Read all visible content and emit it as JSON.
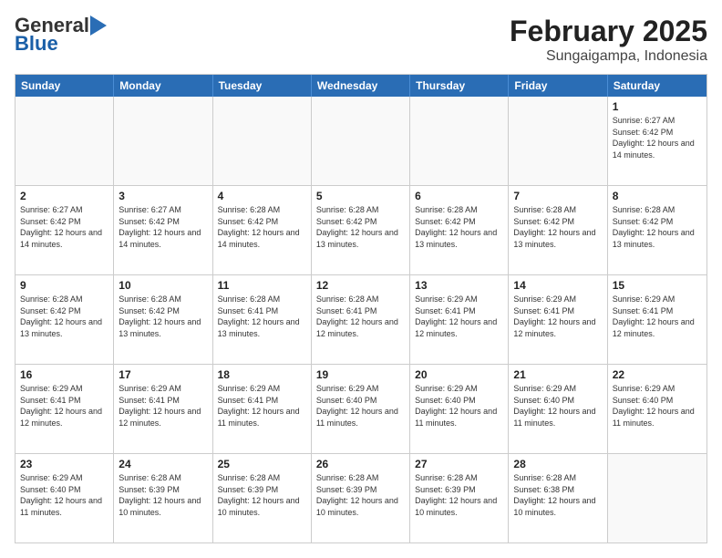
{
  "header": {
    "logo_general": "General",
    "logo_blue": "Blue",
    "main_title": "February 2025",
    "subtitle": "Sungaigampa, Indonesia"
  },
  "days_of_week": [
    "Sunday",
    "Monday",
    "Tuesday",
    "Wednesday",
    "Thursday",
    "Friday",
    "Saturday"
  ],
  "weeks": [
    [
      {
        "day": "",
        "text": "",
        "empty": true
      },
      {
        "day": "",
        "text": "",
        "empty": true
      },
      {
        "day": "",
        "text": "",
        "empty": true
      },
      {
        "day": "",
        "text": "",
        "empty": true
      },
      {
        "day": "",
        "text": "",
        "empty": true
      },
      {
        "day": "",
        "text": "",
        "empty": true
      },
      {
        "day": "1",
        "text": "Sunrise: 6:27 AM\nSunset: 6:42 PM\nDaylight: 12 hours and 14 minutes.",
        "empty": false
      }
    ],
    [
      {
        "day": "2",
        "text": "Sunrise: 6:27 AM\nSunset: 6:42 PM\nDaylight: 12 hours and 14 minutes.",
        "empty": false
      },
      {
        "day": "3",
        "text": "Sunrise: 6:27 AM\nSunset: 6:42 PM\nDaylight: 12 hours and 14 minutes.",
        "empty": false
      },
      {
        "day": "4",
        "text": "Sunrise: 6:28 AM\nSunset: 6:42 PM\nDaylight: 12 hours and 14 minutes.",
        "empty": false
      },
      {
        "day": "5",
        "text": "Sunrise: 6:28 AM\nSunset: 6:42 PM\nDaylight: 12 hours and 13 minutes.",
        "empty": false
      },
      {
        "day": "6",
        "text": "Sunrise: 6:28 AM\nSunset: 6:42 PM\nDaylight: 12 hours and 13 minutes.",
        "empty": false
      },
      {
        "day": "7",
        "text": "Sunrise: 6:28 AM\nSunset: 6:42 PM\nDaylight: 12 hours and 13 minutes.",
        "empty": false
      },
      {
        "day": "8",
        "text": "Sunrise: 6:28 AM\nSunset: 6:42 PM\nDaylight: 12 hours and 13 minutes.",
        "empty": false
      }
    ],
    [
      {
        "day": "9",
        "text": "Sunrise: 6:28 AM\nSunset: 6:42 PM\nDaylight: 12 hours and 13 minutes.",
        "empty": false
      },
      {
        "day": "10",
        "text": "Sunrise: 6:28 AM\nSunset: 6:42 PM\nDaylight: 12 hours and 13 minutes.",
        "empty": false
      },
      {
        "day": "11",
        "text": "Sunrise: 6:28 AM\nSunset: 6:41 PM\nDaylight: 12 hours and 13 minutes.",
        "empty": false
      },
      {
        "day": "12",
        "text": "Sunrise: 6:28 AM\nSunset: 6:41 PM\nDaylight: 12 hours and 12 minutes.",
        "empty": false
      },
      {
        "day": "13",
        "text": "Sunrise: 6:29 AM\nSunset: 6:41 PM\nDaylight: 12 hours and 12 minutes.",
        "empty": false
      },
      {
        "day": "14",
        "text": "Sunrise: 6:29 AM\nSunset: 6:41 PM\nDaylight: 12 hours and 12 minutes.",
        "empty": false
      },
      {
        "day": "15",
        "text": "Sunrise: 6:29 AM\nSunset: 6:41 PM\nDaylight: 12 hours and 12 minutes.",
        "empty": false
      }
    ],
    [
      {
        "day": "16",
        "text": "Sunrise: 6:29 AM\nSunset: 6:41 PM\nDaylight: 12 hours and 12 minutes.",
        "empty": false
      },
      {
        "day": "17",
        "text": "Sunrise: 6:29 AM\nSunset: 6:41 PM\nDaylight: 12 hours and 12 minutes.",
        "empty": false
      },
      {
        "day": "18",
        "text": "Sunrise: 6:29 AM\nSunset: 6:41 PM\nDaylight: 12 hours and 11 minutes.",
        "empty": false
      },
      {
        "day": "19",
        "text": "Sunrise: 6:29 AM\nSunset: 6:40 PM\nDaylight: 12 hours and 11 minutes.",
        "empty": false
      },
      {
        "day": "20",
        "text": "Sunrise: 6:29 AM\nSunset: 6:40 PM\nDaylight: 12 hours and 11 minutes.",
        "empty": false
      },
      {
        "day": "21",
        "text": "Sunrise: 6:29 AM\nSunset: 6:40 PM\nDaylight: 12 hours and 11 minutes.",
        "empty": false
      },
      {
        "day": "22",
        "text": "Sunrise: 6:29 AM\nSunset: 6:40 PM\nDaylight: 12 hours and 11 minutes.",
        "empty": false
      }
    ],
    [
      {
        "day": "23",
        "text": "Sunrise: 6:29 AM\nSunset: 6:40 PM\nDaylight: 12 hours and 11 minutes.",
        "empty": false
      },
      {
        "day": "24",
        "text": "Sunrise: 6:28 AM\nSunset: 6:39 PM\nDaylight: 12 hours and 10 minutes.",
        "empty": false
      },
      {
        "day": "25",
        "text": "Sunrise: 6:28 AM\nSunset: 6:39 PM\nDaylight: 12 hours and 10 minutes.",
        "empty": false
      },
      {
        "day": "26",
        "text": "Sunrise: 6:28 AM\nSunset: 6:39 PM\nDaylight: 12 hours and 10 minutes.",
        "empty": false
      },
      {
        "day": "27",
        "text": "Sunrise: 6:28 AM\nSunset: 6:39 PM\nDaylight: 12 hours and 10 minutes.",
        "empty": false
      },
      {
        "day": "28",
        "text": "Sunrise: 6:28 AM\nSunset: 6:38 PM\nDaylight: 12 hours and 10 minutes.",
        "empty": false
      },
      {
        "day": "",
        "text": "",
        "empty": true
      }
    ]
  ]
}
